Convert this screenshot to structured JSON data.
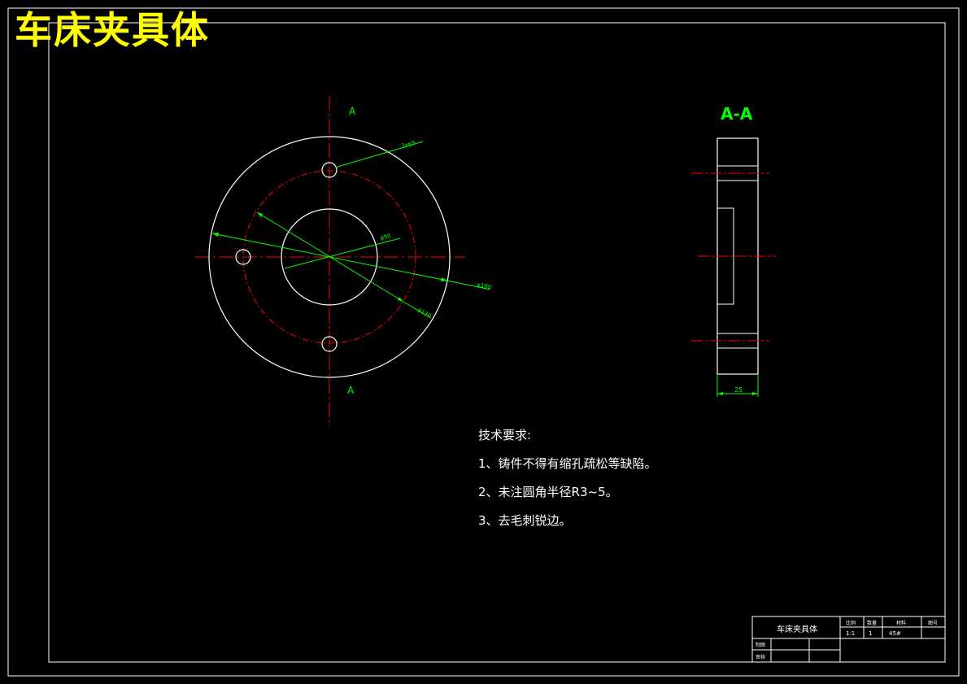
{
  "drawing": {
    "title": "车床夹具体"
  },
  "front_view": {
    "section_mark_top": "A",
    "section_mark_bottom": "A",
    "dims": {
      "holes": "3xφ9",
      "inner": "φ90",
      "outer": "φ180",
      "pitch": "φ130"
    }
  },
  "section_view": {
    "label": "A-A",
    "thickness_dim": "25"
  },
  "tech_notes": {
    "heading": "技术要求:",
    "items": [
      "1、铸件不得有缩孔疏松等缺陷。",
      "2、未注圆角半径R3~5。",
      "3、去毛刺锐边。"
    ]
  },
  "title_block": {
    "part_name": "车床夹具体",
    "headers": [
      "比例",
      "数量",
      "材料",
      "图号"
    ],
    "values": [
      "1:1",
      "1",
      "45#",
      ""
    ],
    "row_labels": [
      "制图",
      "审核"
    ]
  },
  "colors": {
    "background": "#000000",
    "outline": "#ffffff",
    "centerline": "#ff0000",
    "dimension": "#00ff00",
    "title": "#ffff00"
  }
}
